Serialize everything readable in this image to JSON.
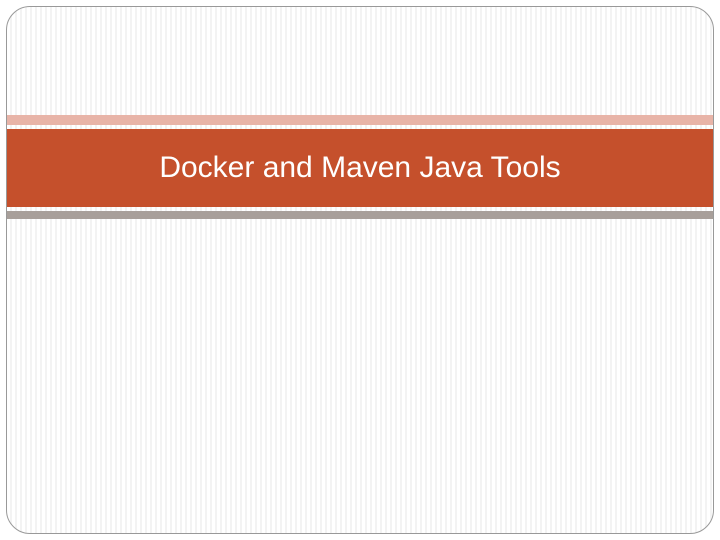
{
  "slide": {
    "title": "Docker and Maven Java Tools"
  }
}
